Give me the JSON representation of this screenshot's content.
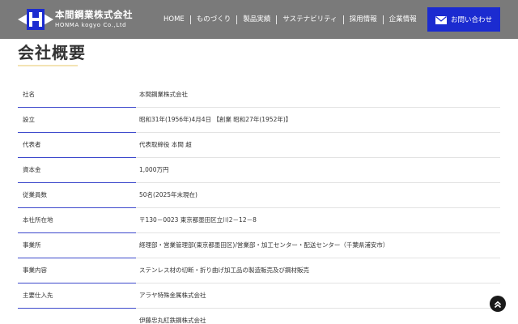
{
  "header": {
    "company_jp": "本間鋼業株式会社",
    "company_en": "HONMA kogyo Co.,Ltd",
    "nav": [
      {
        "label": "HOME"
      },
      {
        "label": "ものづくり"
      },
      {
        "label": "製品実績"
      },
      {
        "label": "サステナビリティ"
      },
      {
        "label": "採用情報"
      },
      {
        "label": "企業情報"
      }
    ],
    "contact_label": "お問い合わせ",
    "colors": {
      "header_bg": "#7a7a7a",
      "contact_bg": "#1b2bd0",
      "accent_line": "#3d49cc"
    }
  },
  "page": {
    "title": "会社概要"
  },
  "company_info": [
    {
      "label": "社名",
      "value": "本間鋼業株式会社"
    },
    {
      "label": "設立",
      "value": "昭和31年(1956年)4月4日 【創業 昭和27年(1952年)】"
    },
    {
      "label": "代表者",
      "value": "代表取締役 本間 超"
    },
    {
      "label": "資本金",
      "value": "1,000万円"
    },
    {
      "label": "従業員数",
      "value": "50名(2025年末現在)"
    },
    {
      "label": "本社所在地",
      "value": "〒130－0023 東京都墨田区立川2－12－8"
    },
    {
      "label": "事業所",
      "value": "経理部・営業管理部(東京都墨田区)/営業部・加工センター・配送センター（千葉県浦安市）"
    },
    {
      "label": "事業内容",
      "value": "ステンレス材の切断・折り曲げ加工品の製造販売及び鋼材販売"
    },
    {
      "label": "主要仕入先",
      "value": "アラヤ特殊金属株式会社"
    },
    {
      "label": "",
      "value": "伊藤忠丸紅鉄鋼株式会社"
    }
  ]
}
